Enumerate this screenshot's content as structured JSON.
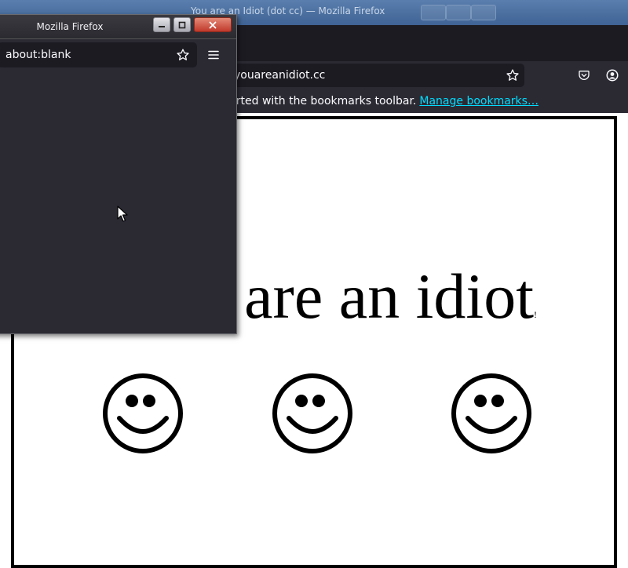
{
  "main_window": {
    "title": "You are an Idiot (dot cc) — Mozilla Firefox",
    "url": "youareanidiot.cc",
    "bookmarks_text": "Get started with the bookmarks toolbar.",
    "bookmarks_link": "Manage bookmarks…"
  },
  "page": {
    "headline": "You are an idiot",
    "headline_tail": "!",
    "smiley_count": 3
  },
  "popup_window": {
    "title": "Mozilla Firefox",
    "url": "about:blank"
  },
  "icons": {
    "bookmark": "star-icon",
    "pocket": "pocket-icon",
    "account": "account-icon",
    "menu": "hamburger-menu-icon",
    "cursor": "mouse-pointer-icon"
  },
  "colors": {
    "toolbar": "#2b2a33",
    "background": "#1c1b22",
    "link": "#00ddff",
    "titlebar": "#4a6fa0"
  }
}
